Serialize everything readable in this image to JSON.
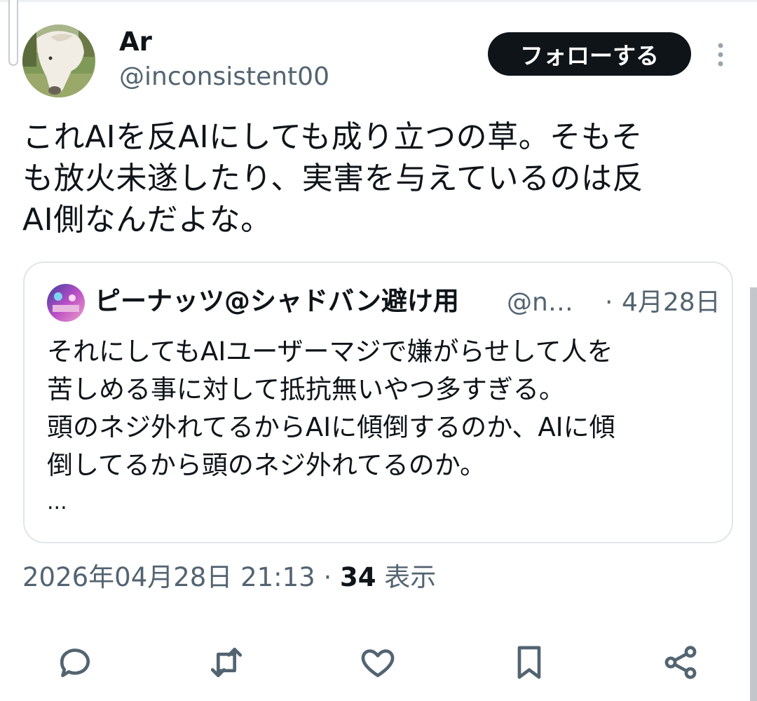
{
  "author": {
    "display_name": "Ar",
    "handle": "@inconsistent00"
  },
  "follow_button_label": "フォローする",
  "tweet": {
    "text": "これAIを反AIにしても成り立つの草。そもそ\nも放火未遂したり、実害を与えているのは反\nAI側なんだよな。"
  },
  "quote": {
    "display_name": "ピーナッツ@シャドバン避け用",
    "handle": "@n…",
    "separator": "·",
    "date": "4月28日",
    "text": "それにしてもAIユーザーマジで嫌がらせして人を\n苦しめる事に対して抵抗無いやつ多すぎる。\n頭のネジ外れてるからAIに傾倒するのか、AIに傾\n倒してるから頭のネジ外れてるのか。",
    "ellipsis": "..."
  },
  "meta": {
    "timestamp": "2026年04月28日 21:13",
    "separator": "·",
    "views_count": "34",
    "views_label": "表示"
  },
  "actions": {
    "icons": [
      "reply-icon",
      "retweet-icon",
      "like-icon",
      "bookmark-icon",
      "share-icon"
    ],
    "icon_color": "#536471"
  },
  "colors": {
    "text_primary": "#0f1419",
    "text_secondary": "#536471",
    "button_bg": "#0f1419",
    "border": "#e1e6ea"
  }
}
